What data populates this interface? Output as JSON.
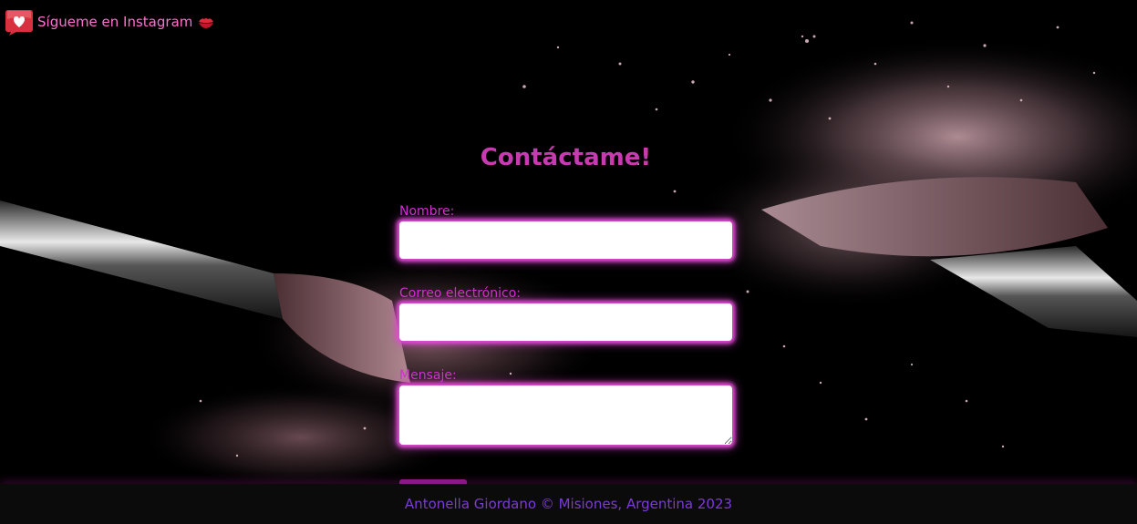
{
  "header": {
    "instagram_link_label": "Sígueme en Instagram",
    "instagram_icon": "heart-speech-bubble-icon",
    "lips_icon": "kiss-lips-icon"
  },
  "contact_form": {
    "title": "Contáctame!",
    "name_label": "Nombre:",
    "name_value": "",
    "email_label": "Correo electrónico:",
    "email_value": "",
    "message_label": "Mensaje:",
    "message_value": ""
  },
  "footer": {
    "text": "Antonella Giordano © Misiones, Argentina 2023"
  },
  "colors": {
    "accent_pink": "#c63bb0",
    "label_magenta": "#d22fd0",
    "footer_purple": "#7c3ad6",
    "glow": "#e24bd6"
  }
}
